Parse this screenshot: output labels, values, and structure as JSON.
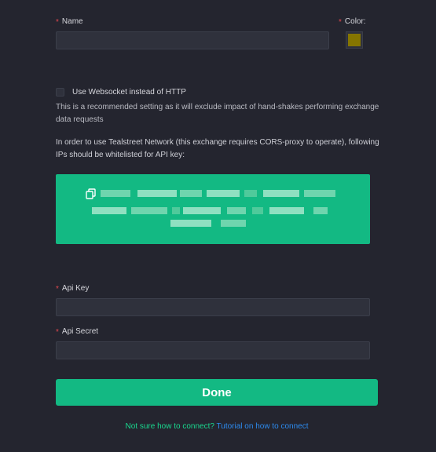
{
  "form": {
    "name": {
      "label": "Name",
      "value": ""
    },
    "color": {
      "label": "Color:",
      "value": "#857500"
    },
    "websocket": {
      "label": "Use Websocket instead of HTTP",
      "checked": false
    },
    "websocket_hint_1": "This is a recommended setting as it will exclude impact of hand-shakes performing exchange",
    "websocket_hint_2": "data requests",
    "proxy_note_1": "In order to use Tealstreet Network (this exchange requires CORS-proxy to operate), following",
    "proxy_note_2": "IPs should be whitelisted for API key:",
    "api_key": {
      "label": "Api Key",
      "value": ""
    },
    "api_secret": {
      "label": "Api Secret",
      "value": ""
    },
    "done_label": "Done"
  },
  "footer": {
    "hint": "Not sure how to connect?",
    "link": "Tutorial on how to connect"
  },
  "icons": {
    "copy": "copy-icon"
  }
}
